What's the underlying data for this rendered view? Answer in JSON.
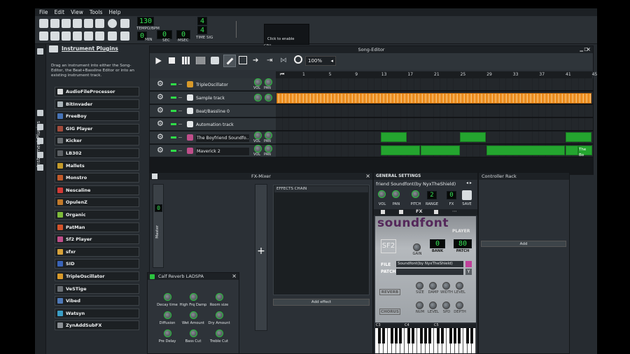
{
  "menu": [
    "File",
    "Edit",
    "View",
    "Tools",
    "Help"
  ],
  "toolbar": {
    "tempo": "130",
    "tempo_label": "TEMPO/BPM",
    "min": "0",
    "sec": "0",
    "msec": "0",
    "min_label": "MIN",
    "sec_label": "SEC",
    "msec_label": "MSEC",
    "ts_num": "4",
    "ts_den": "4",
    "ts_label": "TIME SIG",
    "click_enable": "Click to enable",
    "cpu_label": "CPU"
  },
  "sidebar": {
    "tab_label": "Instrument Plugins"
  },
  "plugins": {
    "title": "Instrument Plugins",
    "description": "Drag an instrument into either the Song-Editor, the Beat+Bassline Editor or into an existing instrument track.",
    "items": [
      {
        "label": "AudioFileProcessor",
        "color": "#d7d9da"
      },
      {
        "label": "BitInvader",
        "color": "#aab3b8"
      },
      {
        "label": "FreeBoy",
        "color": "#4673b6"
      },
      {
        "label": "GIG Player",
        "color": "#a24b3c"
      },
      {
        "label": "Kicker",
        "color": "#6a6e71"
      },
      {
        "label": "LB302",
        "color": "#5c6064"
      },
      {
        "label": "Mallets",
        "color": "#c49a2a"
      },
      {
        "label": "Monstro",
        "color": "#c25a2a"
      },
      {
        "label": "Nescaline",
        "color": "#d23a36"
      },
      {
        "label": "OpulenZ",
        "color": "#c27a2a"
      },
      {
        "label": "Organic",
        "color": "#7dbb3a"
      },
      {
        "label": "PatMan",
        "color": "#d4532b"
      },
      {
        "label": "Sf2 Player",
        "color": "#c04e8a"
      },
      {
        "label": "sfxr",
        "color": "#d7a23a"
      },
      {
        "label": "SID",
        "color": "#3963b8"
      },
      {
        "label": "TripleOscillator",
        "color": "#d89a2a"
      },
      {
        "label": "VeSTige",
        "color": "#6b7075"
      },
      {
        "label": "Vibed",
        "color": "#4e79b7"
      },
      {
        "label": "Watsyn",
        "color": "#3a9ec6"
      },
      {
        "label": "ZynAddSubFX",
        "color": "#8a8f94"
      }
    ]
  },
  "song_editor": {
    "title": "Song-Editor",
    "zoom": "100%",
    "ruler": [
      "1",
      "5",
      "9",
      "13",
      "17",
      "21",
      "25",
      "29",
      "33",
      "37",
      "41",
      "45"
    ],
    "tracks": [
      {
        "name": "TripleOscillator"
      },
      {
        "name": "Sample track"
      },
      {
        "name": "Beat/Bassline 0"
      },
      {
        "name": "Automation track"
      },
      {
        "name": "The Boyfriend Soundfo..."
      },
      {
        "name": "Maverick 2"
      }
    ],
    "vol_label": "VOL",
    "pan_label": "PAN",
    "clip_label": "The Bo"
  },
  "fx_mixer": {
    "title": "FX-Mixer",
    "master_label": "Master",
    "master_value": "0",
    "effects_chain": "EFFECTS CHAIN",
    "add_effect": "Add effect"
  },
  "calf": {
    "title": "Calf Reverb LADSPA",
    "knobs": [
      "Decay time",
      "High Frq Damp",
      "Room size",
      "Diffusion",
      "Wet Amount",
      "Dry Amount",
      "Pre Delay",
      "Bass Cut",
      "Treble Cut"
    ]
  },
  "sf2": {
    "general": "GENERAL SETTINGS",
    "name": "friend Soundfont(by NyxTheShield)",
    "vol": "VOL",
    "pan": "PAN",
    "pitch": "PITCH",
    "range": "RANGE",
    "range_value": "2",
    "fx_value": "0",
    "fx_label": "FX",
    "save_label": "SAVE",
    "brand": "soundfont",
    "player": "PLAYER",
    "bank": "BANK",
    "patch": "PATCH",
    "bank_value": "0",
    "patch_value": "80",
    "file_label": "FILE",
    "file_value": "Soundfont(by NyxTheShield)",
    "patch_label": "PATCH",
    "reverb": "REVERB",
    "chorus": "CHORUS",
    "gain": "GAIN",
    "knobs1": [
      "SIZE",
      "DAMP",
      "WIDTH",
      "LEVEL"
    ],
    "knobs2": [
      "NUM",
      "LEVEL",
      "SPD",
      "DEPTH"
    ],
    "keys": [
      "C3",
      "C4",
      "C5"
    ]
  },
  "controller_rack": {
    "title": "Controller Rack",
    "add": "Add"
  }
}
